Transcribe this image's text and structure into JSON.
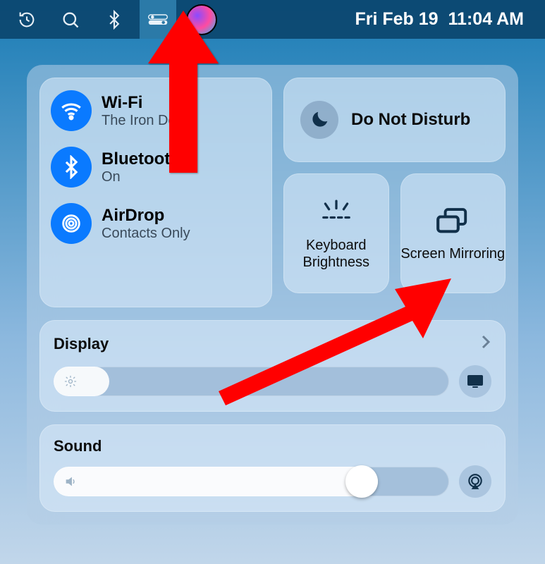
{
  "menubar": {
    "date": "Fri Feb 19",
    "time": "11:04 AM"
  },
  "panel": {
    "wifi": {
      "title": "Wi-Fi",
      "sub": "The Iron Dome"
    },
    "bt": {
      "title": "Bluetooth",
      "sub": "On"
    },
    "airdrop": {
      "title": "AirDrop",
      "sub": "Contacts Only"
    },
    "dnd": {
      "title": "Do Not Disturb"
    },
    "kb": {
      "title": "Keyboard Brightness"
    },
    "mirror": {
      "title": "Screen Mirroring"
    },
    "display": {
      "title": "Display"
    },
    "sound": {
      "title": "Sound"
    }
  }
}
